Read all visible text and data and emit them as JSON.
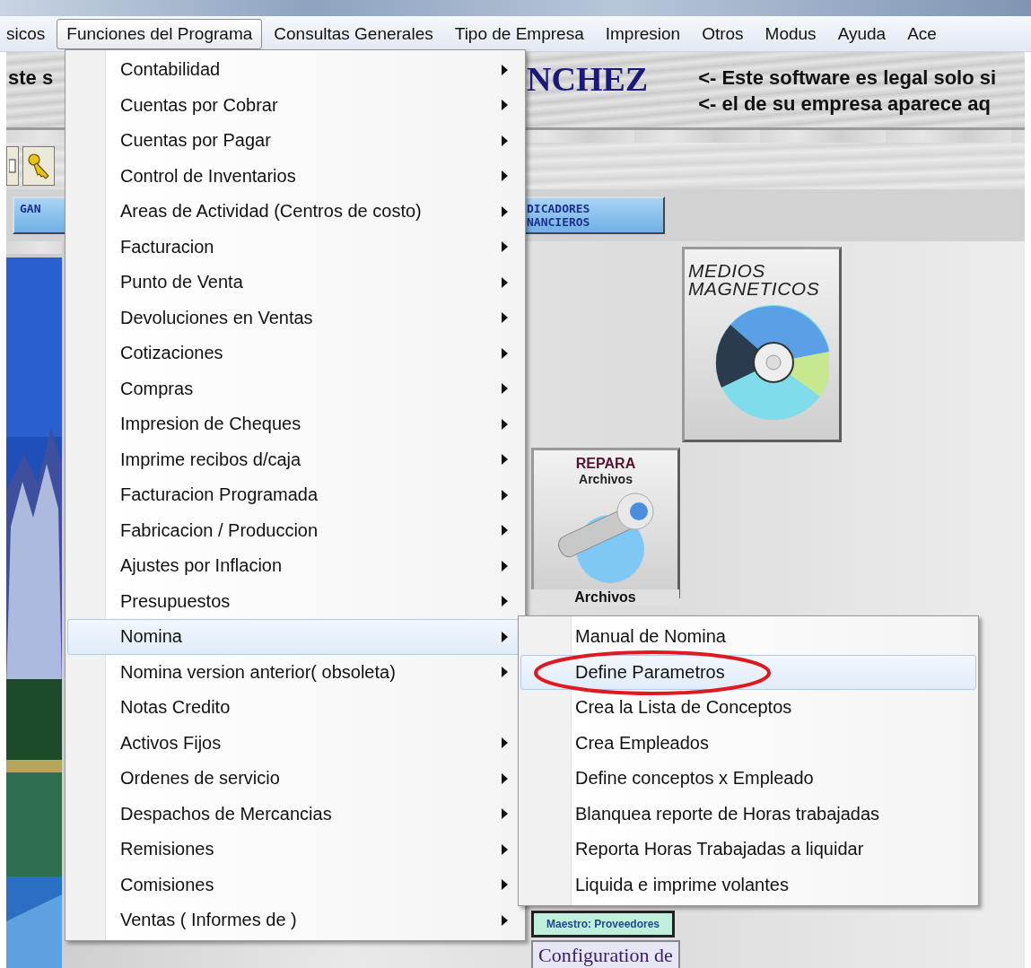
{
  "menu_bar": [
    {
      "label": "sicos",
      "selected": false
    },
    {
      "label": "Funciones del Programa",
      "selected": true
    },
    {
      "label": "Consultas Generales",
      "selected": false
    },
    {
      "label": "Tipo de Empresa",
      "selected": false
    },
    {
      "label": "Impresion",
      "selected": false
    },
    {
      "label": "Otros",
      "selected": false
    },
    {
      "label": "Modus",
      "selected": false
    },
    {
      "label": "Ayuda",
      "selected": false
    },
    {
      "label": "Ace",
      "selected": false
    }
  ],
  "banner": {
    "left_text": "ste s",
    "company": "NCHEZ",
    "notice_lines": [
      "<- Este software es legal solo si",
      "<- el de su empresa aparece aq"
    ]
  },
  "buttons": [
    {
      "label": "GAN"
    },
    {
      "label": "DICADORES NANCIEROS"
    }
  ],
  "tiles": [
    {
      "kind": "disc",
      "title": "MEDIOS MAGNETICOS"
    },
    {
      "kind": "repair",
      "title": "REPARA",
      "subtitle": "Archivos",
      "caption": "Archivos"
    }
  ],
  "bottom_buttons": [
    {
      "kind": "small",
      "label": "Maestro: Proveedores"
    },
    {
      "kind": "large",
      "label": "Configuration de"
    }
  ],
  "menu": {
    "items": [
      {
        "label": "Contabilidad",
        "has_submenu": true,
        "selected": false
      },
      {
        "label": "Cuentas por Cobrar",
        "has_submenu": true,
        "selected": false
      },
      {
        "label": "Cuentas por Pagar",
        "has_submenu": true,
        "selected": false
      },
      {
        "label": "Control de Inventarios",
        "has_submenu": true,
        "selected": false
      },
      {
        "label": "Areas de Actividad (Centros de costo)",
        "has_submenu": true,
        "selected": false
      },
      {
        "label": "Facturacion",
        "has_submenu": true,
        "selected": false
      },
      {
        "label": "Punto de Venta",
        "has_submenu": true,
        "selected": false
      },
      {
        "label": "Devoluciones en Ventas",
        "has_submenu": true,
        "selected": false
      },
      {
        "label": "Cotizaciones",
        "has_submenu": true,
        "selected": false
      },
      {
        "label": "Compras",
        "has_submenu": true,
        "selected": false
      },
      {
        "label": "Impresion de Cheques",
        "has_submenu": true,
        "selected": false
      },
      {
        "label": "Imprime recibos d/caja",
        "has_submenu": true,
        "selected": false
      },
      {
        "label": "Facturacion Programada",
        "has_submenu": true,
        "selected": false
      },
      {
        "label": "Fabricacion / Produccion",
        "has_submenu": true,
        "selected": false
      },
      {
        "label": "Ajustes por Inflacion",
        "has_submenu": true,
        "selected": false
      },
      {
        "label": "Presupuestos",
        "has_submenu": true,
        "selected": false
      },
      {
        "label": "Nomina",
        "has_submenu": true,
        "selected": true
      },
      {
        "label": "Nomina version anterior( obsoleta)",
        "has_submenu": true,
        "selected": false
      },
      {
        "label": "Notas Credito",
        "has_submenu": false,
        "selected": false
      },
      {
        "label": "Activos Fijos",
        "has_submenu": true,
        "selected": false
      },
      {
        "label": "Ordenes de servicio",
        "has_submenu": true,
        "selected": false
      },
      {
        "label": "Despachos de Mercancias",
        "has_submenu": true,
        "selected": false
      },
      {
        "label": "Remisiones",
        "has_submenu": true,
        "selected": false
      },
      {
        "label": "Comisiones",
        "has_submenu": true,
        "selected": false
      },
      {
        "label": "Ventas ( Informes de )",
        "has_submenu": true,
        "selected": false
      }
    ]
  },
  "submenu": {
    "items": [
      {
        "label": "Manual de Nomina",
        "selected": false,
        "circled": false
      },
      {
        "label": "Define Parametros",
        "selected": true,
        "circled": true
      },
      {
        "label": "Crea la Lista de Conceptos",
        "selected": false,
        "circled": false
      },
      {
        "label": "Crea Empleados",
        "selected": false,
        "circled": false
      },
      {
        "label": "Define conceptos x Empleado",
        "selected": false,
        "circled": false
      },
      {
        "label": "Blanquea reporte de Horas trabajadas",
        "selected": false,
        "circled": false
      },
      {
        "label": "Reporta Horas Trabajadas a liquidar",
        "selected": false,
        "circled": false
      },
      {
        "label": "Liquida e imprime volantes",
        "selected": false,
        "circled": false
      }
    ]
  }
}
